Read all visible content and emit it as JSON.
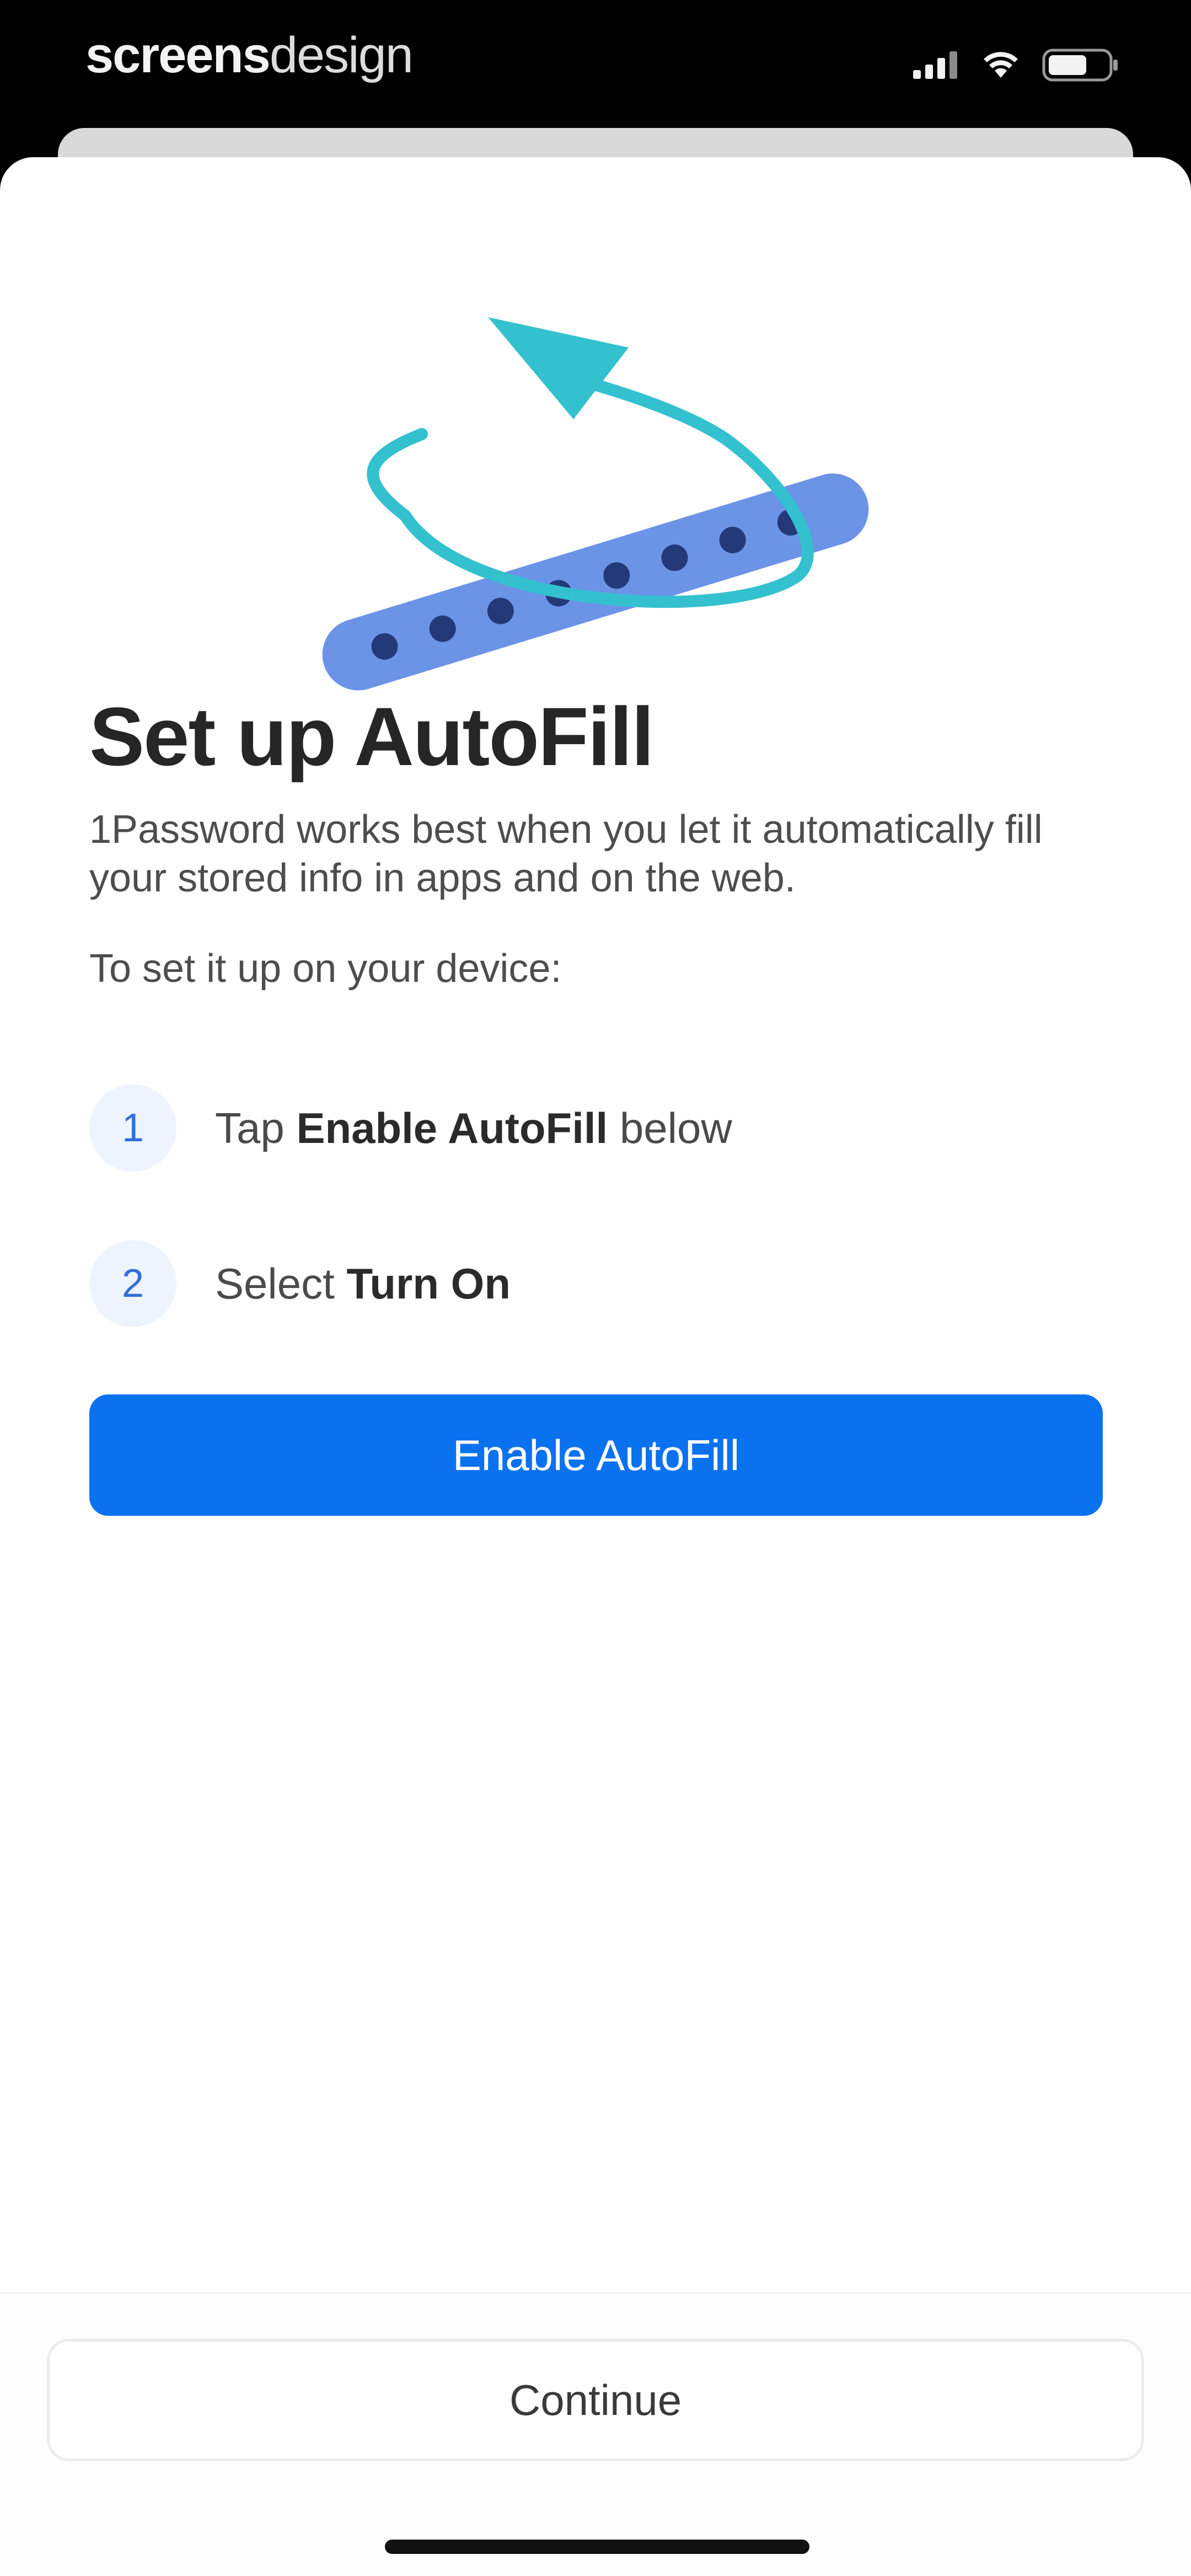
{
  "status_bar": {
    "brand_part1": "screens",
    "brand_part2": "design",
    "icons": [
      "cellular-signal-icon",
      "wifi-icon",
      "battery-icon"
    ]
  },
  "illustration": {
    "icon": "autofill-password-refresh-illustration",
    "colors": {
      "bar": "#6b93e6",
      "dots": "#243a78",
      "arrow": "#34c1cf"
    }
  },
  "content": {
    "title": "Set up AutoFill",
    "description": "1Password works best when you let it automatically fill your stored info in apps and on the web.",
    "instructions": "To set it up on your device:",
    "steps": [
      {
        "number": "1",
        "prefix": "Tap ",
        "bold": "Enable AutoFill",
        "suffix": " below"
      },
      {
        "number": "2",
        "prefix": "Select ",
        "bold": "Turn On",
        "suffix": ""
      }
    ]
  },
  "actions": {
    "primary_label": "Enable AutoFill",
    "secondary_label": "Continue"
  },
  "colors": {
    "accent": "#0a72ef",
    "step_badge_bg": "#eef4fe",
    "step_badge_text": "#2f6fd9"
  }
}
